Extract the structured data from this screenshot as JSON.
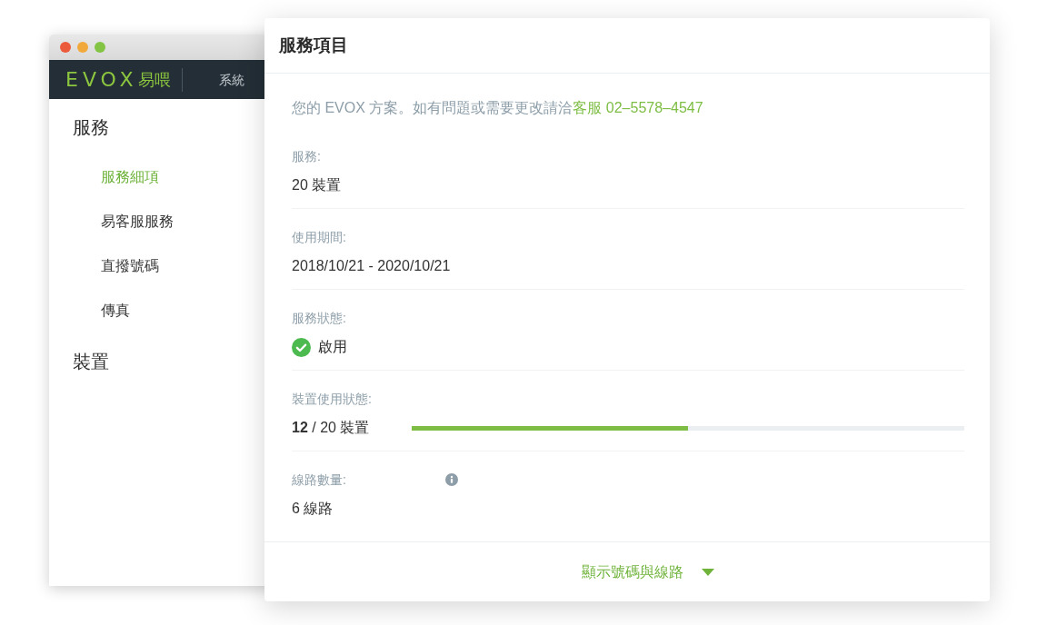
{
  "back_window": {
    "logo": {
      "wordmark": "EVOX",
      "name": "易喂"
    },
    "nav_items": [
      "系統"
    ],
    "sidebar": [
      {
        "title": "服務",
        "items": [
          {
            "label": "服務細項",
            "selected": true
          },
          {
            "label": "易客服服務",
            "selected": false
          },
          {
            "label": "直撥號碼",
            "selected": false
          },
          {
            "label": "傳真",
            "selected": false
          }
        ]
      },
      {
        "title": "裝置"
      }
    ]
  },
  "card": {
    "title": "服務項目",
    "intro": {
      "text": "您的 EVOX 方案。如有問題或需要更改請洽",
      "link": "客服 02–5578–4547"
    },
    "fields": [
      {
        "kind": "text",
        "label": "服務:",
        "value": "20 裝置"
      },
      {
        "kind": "text",
        "label": "使用期間:",
        "value": "2018/10/21 - 2020/10/21"
      },
      {
        "kind": "status",
        "label": "服務狀態:",
        "value": "啟用",
        "on": true
      },
      {
        "kind": "progress",
        "label": "裝置使用狀態:",
        "value": "**12** / 20 裝置",
        "level": 0.5
      },
      {
        "kind": "info",
        "label": "線路數量:",
        "value": "6 線路"
      }
    ],
    "footer": {
      "label": "顯示號碼與線路",
      "expanded": false
    }
  }
}
